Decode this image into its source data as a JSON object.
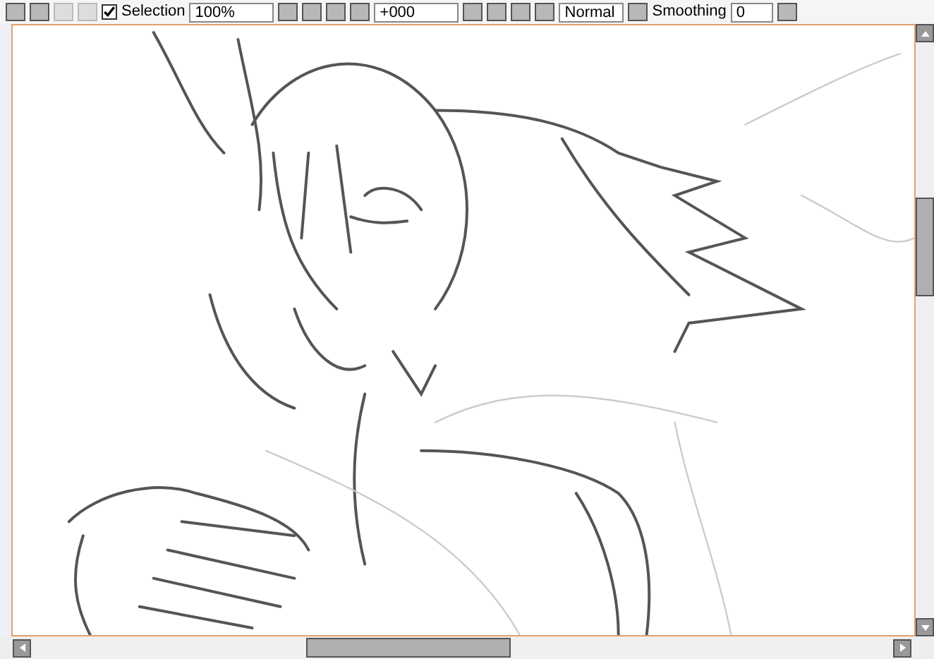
{
  "toolbar": {
    "selection": {
      "label": "Selection",
      "checked": true
    },
    "zoom": {
      "value": "100%"
    },
    "angle": {
      "value": "+000"
    },
    "blend_mode": {
      "value": "Normal"
    },
    "smoothing": {
      "label": "Smoothing",
      "value": "0"
    }
  }
}
